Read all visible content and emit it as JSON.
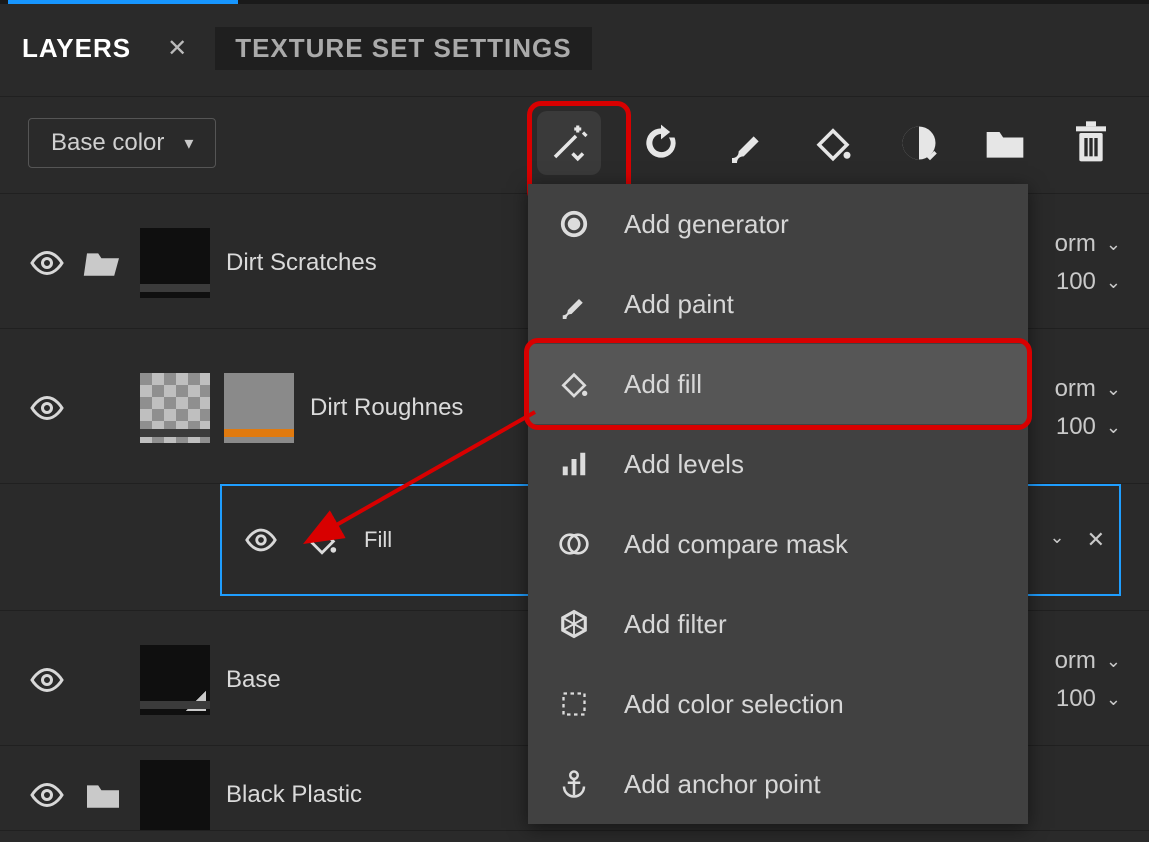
{
  "tabs": {
    "layers": "LAYERS",
    "settings": "TEXTURE SET SETTINGS"
  },
  "channel": "Base color",
  "toolbar": [
    "wand",
    "refresh",
    "brush",
    "bucket",
    "smart-material",
    "folder",
    "trash"
  ],
  "layers": [
    {
      "name": "Dirt Scratches",
      "blend": "orm",
      "opacity": "100"
    },
    {
      "name": "Dirt Roughnes",
      "blend": "orm",
      "opacity": "100"
    },
    {
      "name": "Base",
      "blend": "orm",
      "opacity": "100"
    },
    {
      "name": "Black Plastic",
      "blend": "",
      "opacity": ""
    }
  ],
  "sublayer": {
    "name": "Fill"
  },
  "menu": {
    "items": [
      {
        "icon": "generator",
        "label": "Add generator"
      },
      {
        "icon": "brush",
        "label": "Add paint"
      },
      {
        "icon": "bucket",
        "label": "Add fill"
      },
      {
        "icon": "levels",
        "label": "Add levels"
      },
      {
        "icon": "compare",
        "label": "Add compare mask"
      },
      {
        "icon": "filter",
        "label": "Add filter"
      },
      {
        "icon": "selection",
        "label": "Add color selection"
      },
      {
        "icon": "anchor",
        "label": "Add anchor point"
      }
    ],
    "highlighted": 2
  }
}
